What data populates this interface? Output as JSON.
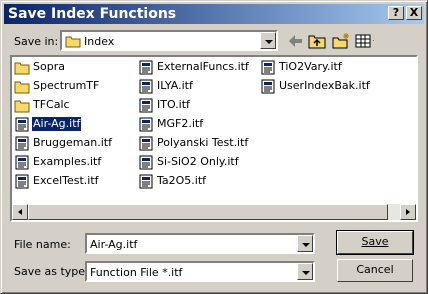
{
  "window": {
    "title": "Save Index Functions"
  },
  "title_buttons": {
    "help": "?",
    "close": "X"
  },
  "save_in": {
    "label": "Save in:",
    "value": "Index"
  },
  "files": [
    {
      "name": "Sopra",
      "kind": "folder"
    },
    {
      "name": "SpectrumTF",
      "kind": "folder"
    },
    {
      "name": "TFCalc",
      "kind": "folder"
    },
    {
      "name": "Air-Ag.itf",
      "kind": "file",
      "selected": true
    },
    {
      "name": "Bruggeman.itf",
      "kind": "file"
    },
    {
      "name": "Examples.itf",
      "kind": "file"
    },
    {
      "name": "ExcelTest.itf",
      "kind": "file"
    },
    {
      "name": "ExternalFuncs.itf",
      "kind": "file"
    },
    {
      "name": "ILYA.itf",
      "kind": "file"
    },
    {
      "name": "ITO.itf",
      "kind": "file"
    },
    {
      "name": "MGF2.itf",
      "kind": "file"
    },
    {
      "name": "Polyanski Test.itf",
      "kind": "file"
    },
    {
      "name": "Si-SiO2 Only.itf",
      "kind": "file"
    },
    {
      "name": "Ta2O5.itf",
      "kind": "file"
    },
    {
      "name": "TiO2Vary.itf",
      "kind": "file"
    },
    {
      "name": "UserIndexBak.itf",
      "kind": "file"
    }
  ],
  "file_name": {
    "label": "File name:",
    "value": "Air-Ag.itf"
  },
  "save_type": {
    "label": "Save as type:",
    "value": "Function File *.itf"
  },
  "buttons": {
    "save": "Save",
    "cancel": "Cancel"
  },
  "colors": {
    "titlebar_start": "#0a246a",
    "titlebar_end": "#a6caf0",
    "face": "#d4d0c8",
    "selection": "#0a246a",
    "folder": "#f6d86b"
  }
}
